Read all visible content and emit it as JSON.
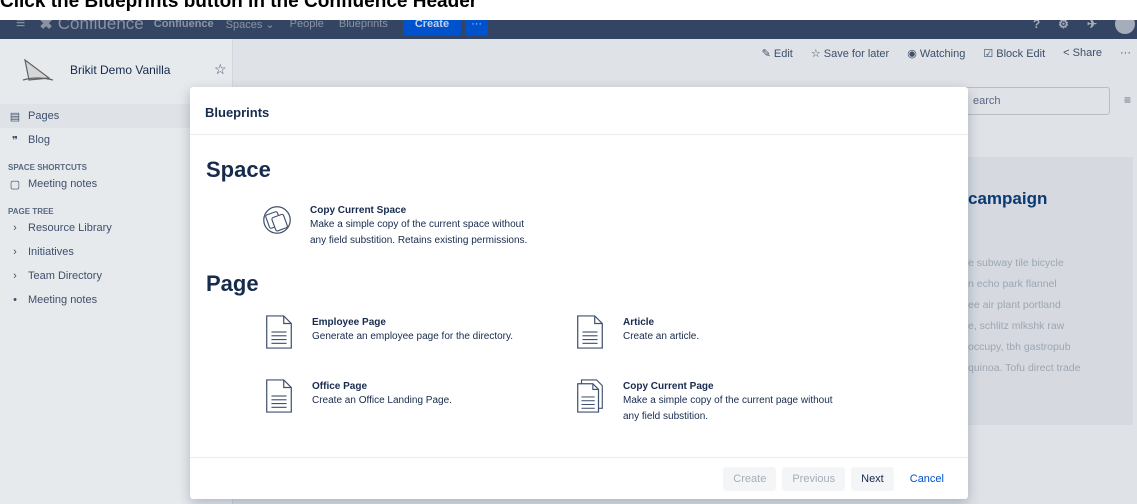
{
  "caption": "Click the Blueprints button in the Confluence Header",
  "header": {
    "menu_icon": "≡",
    "logo_glyph": "✖",
    "logo_text": "Confluence",
    "brand": "Confluence",
    "nav": [
      "Spaces ⌄",
      "People",
      "Blueprints"
    ],
    "create": "Create",
    "more": "···",
    "right_icons": [
      "?",
      "⚙",
      "✈"
    ]
  },
  "sidebar": {
    "space_name": "Brikit Demo Vanilla",
    "star": "☆",
    "items": [
      {
        "icon": "▤",
        "label": "Pages"
      },
      {
        "icon": "❞",
        "label": "Blog"
      }
    ],
    "shortcuts_head": "SPACE SHORTCUTS",
    "shortcut": {
      "icon": "▢",
      "label": "Meeting notes"
    },
    "tree_head": "PAGE TREE",
    "tree": [
      {
        "icon": "›",
        "label": "Resource Library"
      },
      {
        "icon": "›",
        "label": "Initiatives"
      },
      {
        "icon": "›",
        "label": "Team Directory"
      },
      {
        "icon": "•",
        "label": "Meeting notes"
      }
    ]
  },
  "toolbar": {
    "edit": "✎ Edit",
    "save": "☆ Save for later",
    "watching": "◉ Watching",
    "block_edit": "☑ Block Edit",
    "share": "< Share",
    "more": "···"
  },
  "page": {
    "search": "earch",
    "menu": "≡",
    "heading": "campaign",
    "lorem": [
      "e subway tile bicycle",
      "n echo park flannel",
      "ee air plant portland",
      "e, schlitz mlkshk raw",
      "occupy, tbh gastropub",
      "quinoa. Tofu direct trade"
    ]
  },
  "modal": {
    "title": "Blueprints",
    "space_section": "Space",
    "page_section": "Page",
    "space_blueprint": {
      "title": "Copy Current Space",
      "desc1": "Make a simple copy of the current space without",
      "desc2": "any field substition. Retains existing permissions."
    },
    "page_blueprints": [
      {
        "title": "Employee Page",
        "desc1": "Generate an employee page for the directory.",
        "desc2": ""
      },
      {
        "title": "Article",
        "desc1": "Create an article.",
        "desc2": ""
      },
      {
        "title": "Office Page",
        "desc1": "Create an Office Landing Page.",
        "desc2": ""
      },
      {
        "title": "Copy Current Page",
        "desc1": "Make a simple copy of the current page without",
        "desc2": "any field substition."
      }
    ],
    "footer": {
      "create": "Create",
      "previous": "Previous",
      "next": "Next",
      "cancel": "Cancel"
    }
  }
}
